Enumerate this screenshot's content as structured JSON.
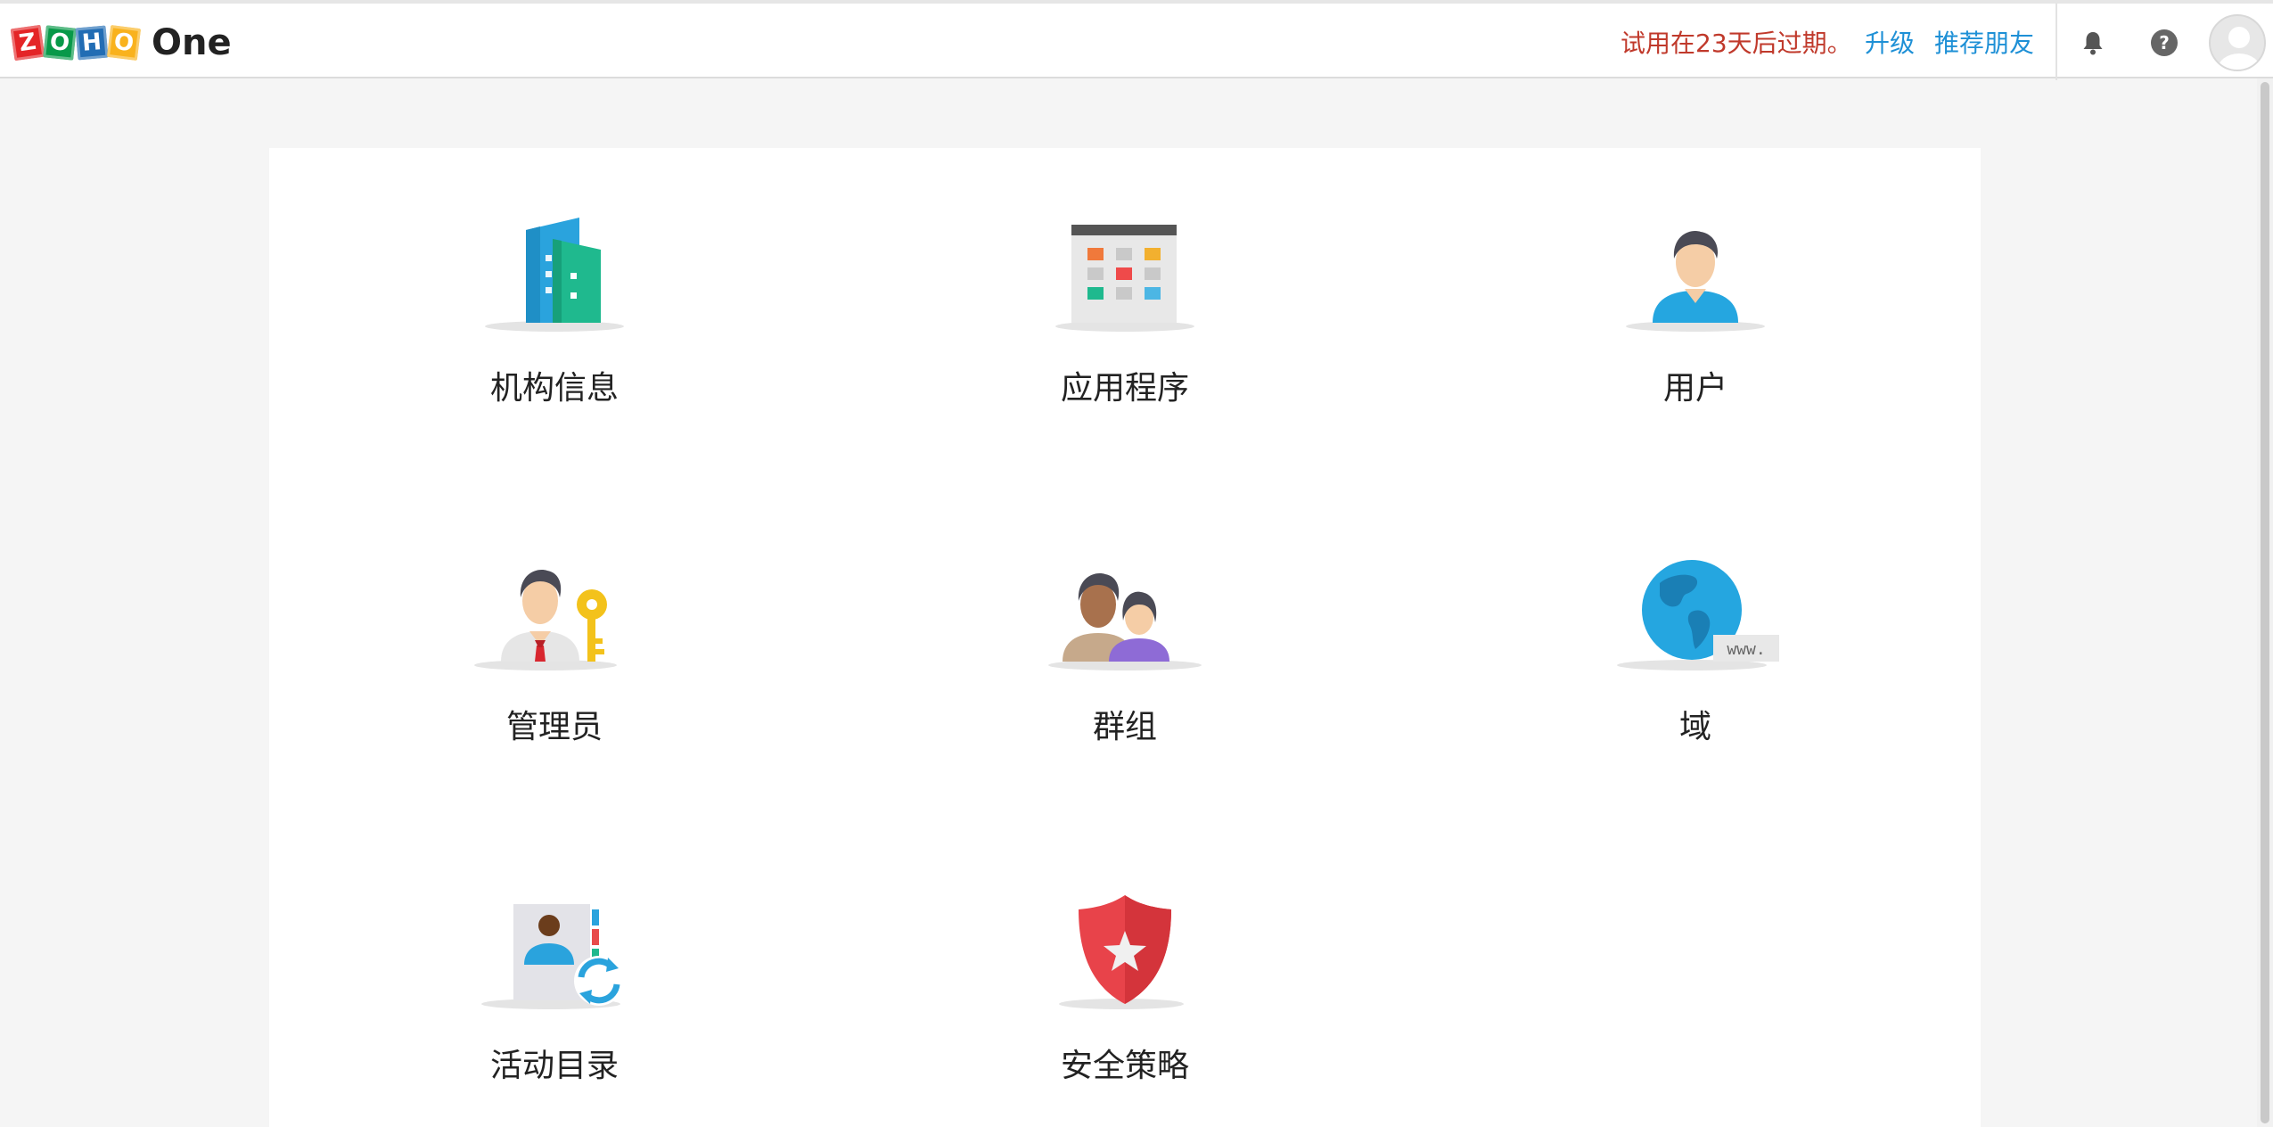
{
  "header": {
    "logo_letters": [
      "Z",
      "O",
      "H",
      "O"
    ],
    "logo_colors": [
      "#e42527",
      "#089949",
      "#226db4",
      "#f9b21d"
    ],
    "product_name": "One",
    "trial_message": "试用在23天后过期。",
    "upgrade_label": "升级",
    "refer_label": "推荐朋友",
    "bell_icon": "bell-icon",
    "help_icon": "help-icon",
    "avatar_icon": "avatar-icon"
  },
  "colors": {
    "accent": "#1e90d6",
    "warning": "#c0392b",
    "background": "#f5f5f5"
  },
  "tiles": [
    {
      "label": "机构信息",
      "icon": "organization-icon"
    },
    {
      "label": "应用程序",
      "icon": "applications-icon"
    },
    {
      "label": "用户",
      "icon": "user-icon"
    },
    {
      "label": "管理员",
      "icon": "admin-icon"
    },
    {
      "label": "群组",
      "icon": "groups-icon"
    },
    {
      "label": "域",
      "icon": "domain-globe-icon"
    },
    {
      "label": "活动目录",
      "icon": "active-directory-icon"
    },
    {
      "label": "安全策略",
      "icon": "security-shield-icon"
    }
  ],
  "domain_badge": "www."
}
